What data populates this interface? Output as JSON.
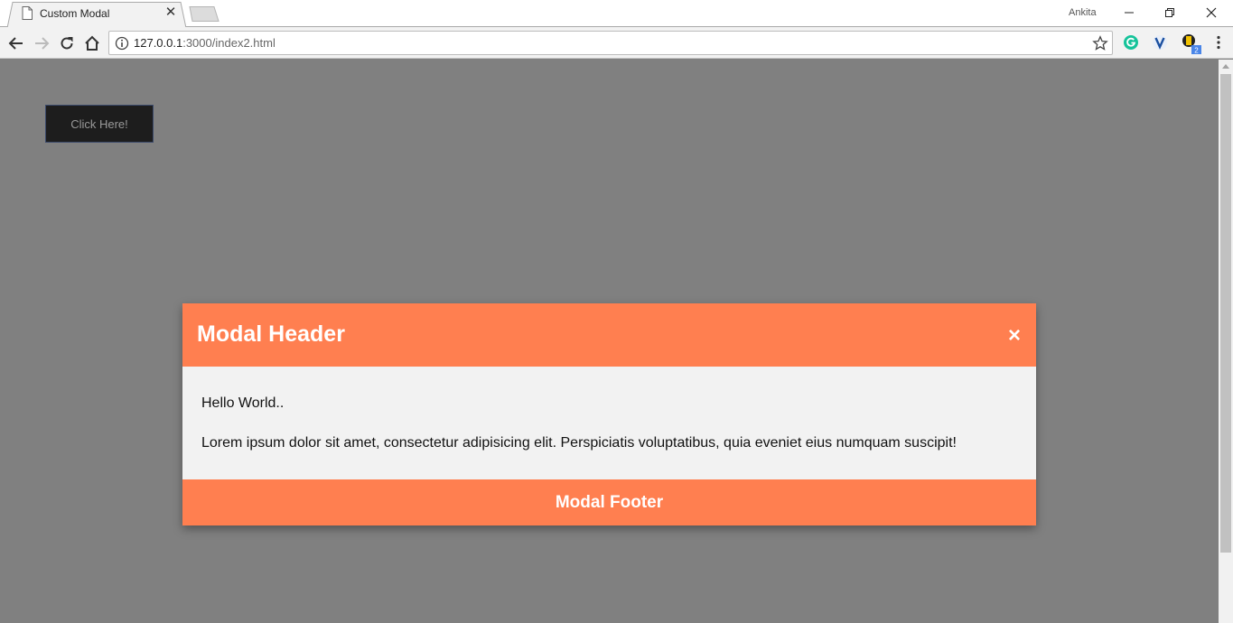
{
  "browser": {
    "tab_title": "Custom Modal",
    "profile_name": "Ankita",
    "url_host": "127.0.0.1",
    "url_rest": ":3000/index2.html",
    "extension_badge": "2"
  },
  "page": {
    "button_label": "Click Here!"
  },
  "modal": {
    "header": "Modal Header",
    "close_glyph": "×",
    "body_line1": "Hello World..",
    "body_line2": "Lorem ipsum dolor sit amet, consectetur adipisicing elit. Perspiciatis voluptatibus, quia eveniet eius numquam suscipit!",
    "footer": "Modal Footer"
  },
  "colors": {
    "modal_accent": "#ff7f50",
    "overlay": "#808080"
  }
}
